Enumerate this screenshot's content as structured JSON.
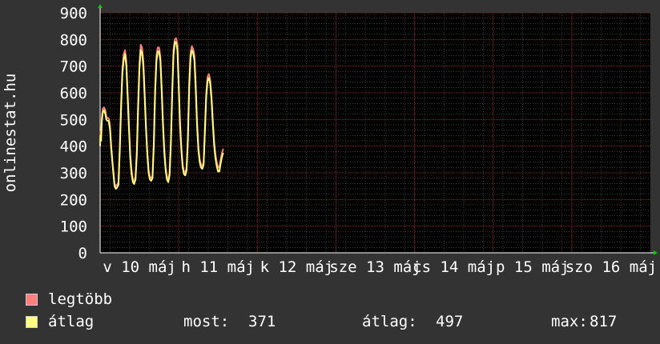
{
  "chart_data": {
    "type": "line",
    "ylabel": "onlinestat.hu",
    "ylim": [
      0,
      900
    ],
    "y_ticks": [
      "0",
      "100",
      "200",
      "300",
      "400",
      "500",
      "600",
      "700",
      "800",
      "900"
    ],
    "x_ticks": [
      "v 10 máj",
      "h 11 máj",
      "k 12 máj",
      "sze 13 máj",
      "cs 14 máj",
      "p 15 máj",
      "szo 16 máj"
    ],
    "grid": true,
    "x": [
      0,
      0.1,
      0.3,
      0.5,
      0.8,
      1.2,
      1.6,
      1.9,
      2.2,
      2.6,
      3.0,
      3.4,
      3.8,
      4.1,
      4.4,
      4.8,
      5.2,
      5.6,
      6.0,
      6.4,
      6.8,
      7.2,
      7.6,
      8.0,
      8.4,
      8.8,
      9.2,
      9.6,
      10.0,
      10.4,
      10.8,
      11.2,
      11.6,
      12.0,
      12.4,
      12.8,
      13.2,
      13.6,
      14.0,
      14.4,
      14.8,
      15.2,
      15.6,
      16.0,
      16.4,
      16.8,
      17.2,
      17.6,
      18.0,
      18.4,
      18.8,
      19.2,
      19.6,
      20.0,
      20.4,
      20.8,
      21.2,
      21.6,
      22.0,
      22.4,
      22.8,
      23.2,
      23.6,
      24.0,
      24.4,
      24.8,
      25.2,
      25.6,
      26.0,
      26.4,
      26.8,
      27.2,
      27.6,
      28.0,
      28.4,
      28.8,
      29.2,
      29.6,
      30.0,
      30.4,
      30.8,
      31.2,
      31.6,
      32.0,
      32.4,
      32.8,
      33.2,
      33.6,
      34.0,
      34.4,
      34.8,
      35.2,
      35.6,
      36.0,
      36.4,
      36.8,
      37.2,
      37.6,
      38.0,
      38.4,
      38.8,
      39.2,
      39.6,
      40.0,
      40.4,
      40.8,
      41.2,
      41.6,
      42.0,
      42.4,
      42.8,
      43.2,
      43.6,
      44.0,
      44.4,
      44.8
    ],
    "series": [
      {
        "name": "legtöbb",
        "color": "#ff7f7f",
        "values": [
          420,
          455,
          440,
          505,
          540,
          545,
          535,
          510,
          505,
          505,
          480,
          400,
          340,
          300,
          260,
          250,
          255,
          265,
          400,
          560,
          690,
          745,
          760,
          720,
          600,
          480,
          370,
          310,
          275,
          265,
          285,
          380,
          560,
          710,
          780,
          770,
          720,
          600,
          480,
          380,
          310,
          285,
          280,
          290,
          420,
          620,
          740,
          770,
          770,
          735,
          620,
          490,
          390,
          320,
          285,
          275,
          300,
          420,
          610,
          760,
          800,
          805,
          780,
          640,
          490,
          400,
          330,
          305,
          300,
          320,
          440,
          640,
          750,
          775,
          765,
          740,
          630,
          490,
          400,
          350,
          330,
          325,
          340,
          470,
          600,
          660,
          670,
          650,
          590,
          500,
          420,
          370,
          340,
          320,
          320,
          350,
          375,
          390
        ],
        "_x_note": "x axis is in hours from the left edge; 24 hours per day label"
      },
      {
        "name": "átlag",
        "color": "#ffff7f",
        "values": [
          400,
          440,
          420,
          490,
          525,
          535,
          520,
          500,
          495,
          495,
          465,
          390,
          330,
          290,
          250,
          240,
          245,
          255,
          380,
          540,
          670,
          725,
          745,
          700,
          585,
          465,
          355,
          295,
          265,
          258,
          275,
          365,
          540,
          690,
          760,
          750,
          700,
          585,
          465,
          370,
          300,
          275,
          270,
          280,
          405,
          600,
          720,
          755,
          755,
          720,
          605,
          475,
          375,
          310,
          275,
          265,
          290,
          405,
          590,
          740,
          790,
          790,
          760,
          620,
          475,
          385,
          320,
          295,
          290,
          310,
          425,
          620,
          730,
          760,
          750,
          720,
          610,
          475,
          385,
          340,
          320,
          315,
          330,
          455,
          585,
          645,
          655,
          635,
          575,
          485,
          405,
          355,
          325,
          305,
          305,
          335,
          360,
          375
        ]
      }
    ],
    "summary": {
      "most_label": "most:",
      "most": "371",
      "atlag_label": "átlag:",
      "atlag": "497",
      "max_label": "max:",
      "max": "817"
    }
  }
}
